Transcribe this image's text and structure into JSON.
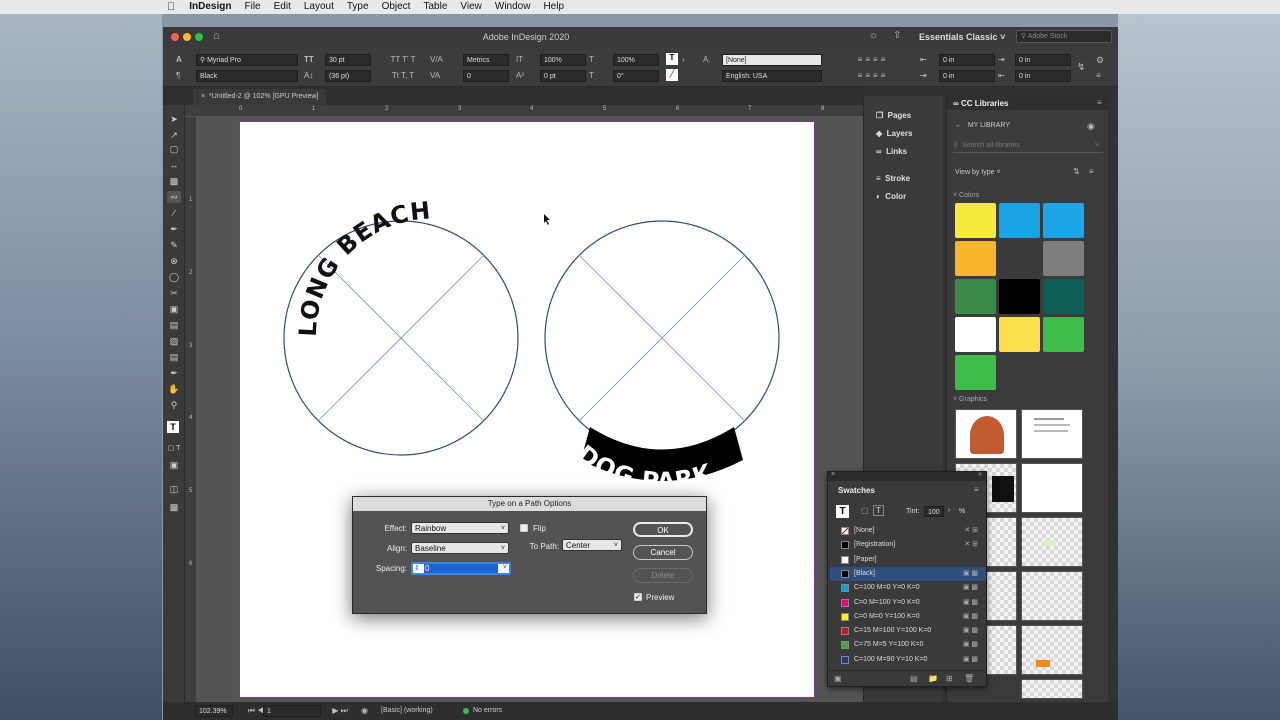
{
  "menubar": {
    "app": "InDesign",
    "items": [
      "File",
      "Edit",
      "Layout",
      "Type",
      "Object",
      "Table",
      "View",
      "Window",
      "Help"
    ]
  },
  "window": {
    "title": "Adobe InDesign 2020",
    "workspace": "Essentials Classic",
    "search_placeholder": "Adobe Stock"
  },
  "control": {
    "font_family": "Myriad Pro",
    "font_style": "Black",
    "size": "30 pt",
    "leading": "(36 pt)",
    "kerning": "Metrics",
    "tracking": "0",
    "vscale": "100%",
    "hscale": "100%",
    "baseline": "0 pt",
    "skew": "0°",
    "char_style": "[None]",
    "language": "English: USA",
    "indent1": "0 in",
    "indent2": "0 in",
    "indent3": "0 in",
    "indent4": "0 in"
  },
  "document": {
    "tab": "*Untitled-2 @ 102% [GPU Preview]"
  },
  "ruler": {
    "top": [
      "0",
      "1",
      "2",
      "3",
      "4",
      "5",
      "6",
      "7",
      "8"
    ],
    "left": [
      "1",
      "2",
      "3",
      "4",
      "5",
      "6"
    ]
  },
  "canvas": {
    "path_text_1": "LONG BEACH",
    "path_text_2": "DOG PARK"
  },
  "status": {
    "zoom": "102.39%",
    "page": "1",
    "style": "[Basic] (working)",
    "preflight": "No errors"
  },
  "panels": {
    "items": [
      "Pages",
      "Layers",
      "Links",
      "Stroke",
      "Color"
    ]
  },
  "cclibraries": {
    "title": "CC Libraries",
    "library": "MY LIBRARY",
    "search": "Search all libraries",
    "view": "View by type",
    "colors_header": "Colors",
    "graphics_header": "Graphics",
    "colors": [
      "#f7ea3a",
      "#19a4e6",
      "#1ca6e8",
      "#f7b52b",
      "#3a3a3a",
      "#7e7e7e",
      "#3b8a45",
      "#000000",
      "#0c5d52",
      "#ffffff",
      "#fbe04d",
      "#3dbd4a",
      "#3dbd4a"
    ]
  },
  "swatches": {
    "title": "Swatches",
    "tint_label": "Tint:",
    "tint": "100",
    "tint_unit": "%",
    "items": [
      {
        "name": "[None]",
        "color": "#ffffff"
      },
      {
        "name": "[Registration]",
        "color": "#000000"
      },
      {
        "name": "[Paper]",
        "color": "#ffffff"
      },
      {
        "name": "[Black]",
        "color": "#000000"
      },
      {
        "name": "C=100 M=0 Y=0 K=0",
        "color": "#00a0e4"
      },
      {
        "name": "C=0 M=100 Y=0 K=0",
        "color": "#e4007f"
      },
      {
        "name": "C=0 M=0 Y=100 K=0",
        "color": "#fff100"
      },
      {
        "name": "C=15 M=100 Y=100 K=0",
        "color": "#c9151e"
      },
      {
        "name": "C=75 M=5 Y=100 K=0",
        "color": "#3aa935"
      },
      {
        "name": "C=100 M=90 Y=10 K=0",
        "color": "#24378a"
      }
    ]
  },
  "dialog": {
    "title": "Type on a Path Options",
    "effect_label": "Effect:",
    "effect": "Rainbow",
    "align_label": "Align:",
    "align": "Baseline",
    "spacing_label": "Spacing:",
    "spacing": "0",
    "flip_label": "Flip",
    "topath_label": "To Path:",
    "topath": "Center",
    "ok": "OK",
    "cancel": "Cancel",
    "delete": "Delete",
    "preview": "Preview"
  }
}
